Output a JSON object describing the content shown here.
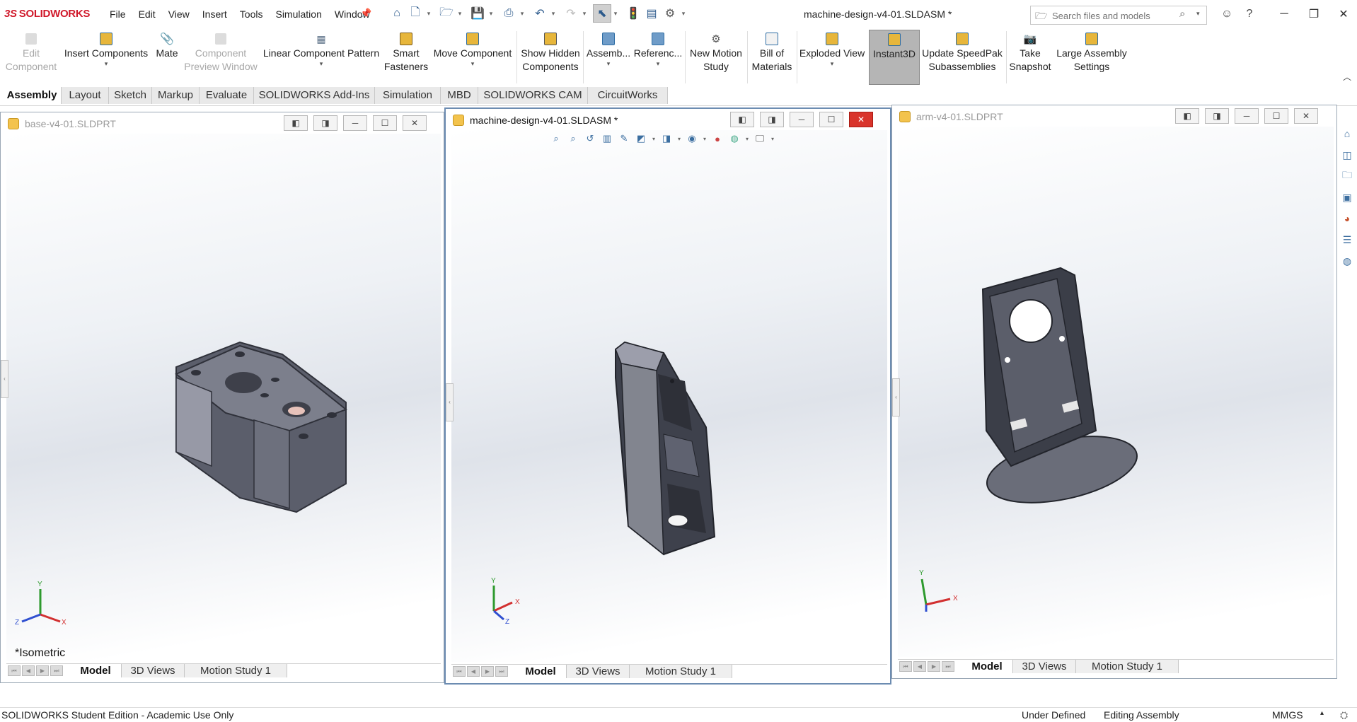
{
  "app": {
    "logo_text_ds": "3S",
    "logo_text": "SOLIDWORKS",
    "doc_title": "machine-design-v4-01.SLDASM *"
  },
  "menu": [
    "File",
    "Edit",
    "View",
    "Insert",
    "Tools",
    "Simulation",
    "Window"
  ],
  "search": {
    "placeholder": "Search files and models"
  },
  "ribbon": {
    "edit_component": [
      "Edit",
      "Component"
    ],
    "insert_components": "Insert Components",
    "mate": "Mate",
    "component_preview": [
      "Component",
      "Preview Window"
    ],
    "linear_pattern": "Linear Component Pattern",
    "smart_fasteners": [
      "Smart",
      "Fasteners"
    ],
    "move_component": "Move Component",
    "show_hidden": [
      "Show Hidden",
      "Components"
    ],
    "assembly": "Assemb...",
    "reference": "Referenc...",
    "new_motion_study": [
      "New Motion",
      "Study"
    ],
    "bill_of_materials": [
      "Bill of",
      "Materials"
    ],
    "exploded_view": "Exploded View",
    "instant3d": "Instant3D",
    "update_speedpak": [
      "Update SpeedPak",
      "Subassemblies"
    ],
    "take_snapshot": [
      "Take",
      "Snapshot"
    ],
    "large_assembly": [
      "Large Assembly",
      "Settings"
    ]
  },
  "tabs": [
    "Assembly",
    "Layout",
    "Sketch",
    "Markup",
    "Evaluate",
    "SOLIDWORKS Add-Ins",
    "Simulation",
    "MBD",
    "SOLIDWORKS CAM",
    "CircuitWorks"
  ],
  "windows": {
    "base": {
      "title": "base-v4-01.SLDPRT",
      "view_label": "*Isometric"
    },
    "machine": {
      "title": "machine-design-v4-01.SLDASM *"
    },
    "arm": {
      "title": "arm-v4-01.SLDPRT"
    }
  },
  "bottom_tabs": [
    "Model",
    "3D Views",
    "Motion Study 1"
  ],
  "triad": {
    "x": "X",
    "y": "Y",
    "z": "Z"
  },
  "status": {
    "left": "SOLIDWORKS Student Edition - Academic Use Only",
    "defined": "Under Defined",
    "mode": "Editing Assembly",
    "units": "MMGS"
  },
  "colors": {
    "brand": "#d0182a",
    "accent": "#6c8cb1",
    "close_hot": "#d9342b"
  }
}
